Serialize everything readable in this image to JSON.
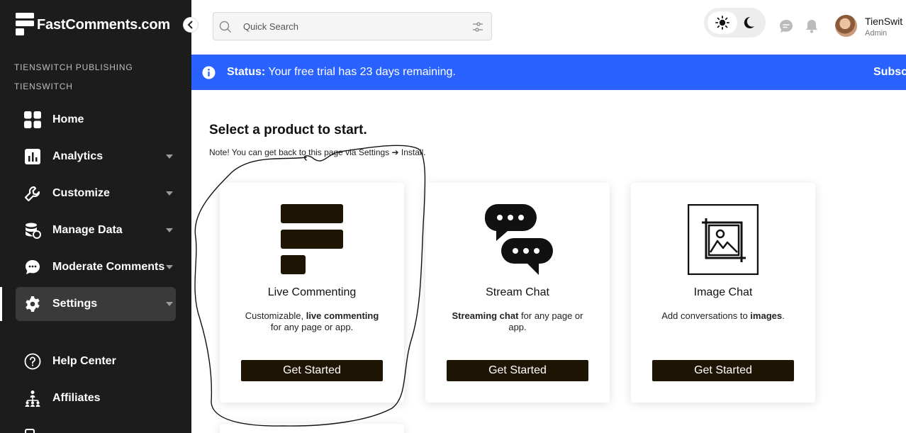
{
  "app": {
    "logo_text": "FastComments.com"
  },
  "org": {
    "line1": "TIENSWITCH PUBLISHING",
    "line2": "TIENSWITCH"
  },
  "sidebar": {
    "items": [
      {
        "label": "Home",
        "icon": "grid-icon"
      },
      {
        "label": "Analytics",
        "icon": "chart-icon"
      },
      {
        "label": "Customize",
        "icon": "wrench-icon"
      },
      {
        "label": "Manage Data",
        "icon": "database-icon"
      },
      {
        "label": "Moderate Comments",
        "icon": "comment-icon"
      },
      {
        "label": "Settings",
        "icon": "gear-icon",
        "active": true
      },
      {
        "label": "Help Center",
        "icon": "help-icon"
      },
      {
        "label": "Affiliates",
        "icon": "network-icon"
      }
    ]
  },
  "search": {
    "placeholder": "Quick Search"
  },
  "user": {
    "name": "TienSwit",
    "role": "Admin"
  },
  "banner": {
    "label": "Status:",
    "message": "Your free trial has 23 days remaining.",
    "action": "Subsc"
  },
  "main": {
    "heading": "Select a product to start.",
    "note": "Note! You can get back to this page via Settings ➔ Install."
  },
  "cards": [
    {
      "title": "Live Commenting",
      "desc_pre": "Customizable, ",
      "desc_bold": "live commenting",
      "desc_post": " for any page or app.",
      "button": "Get Started"
    },
    {
      "title": "Stream Chat",
      "desc_pre": "",
      "desc_bold": "Streaming chat",
      "desc_post": " for any page or app.",
      "button": "Get Started"
    },
    {
      "title": "Image Chat",
      "desc_pre": "Add conversations to ",
      "desc_bold": "images",
      "desc_post": ".",
      "button": "Get Started"
    }
  ],
  "colors": {
    "sidebar_bg": "#1c1c1c",
    "banner_bg": "#2962ff",
    "button_bg": "#1f1505"
  }
}
